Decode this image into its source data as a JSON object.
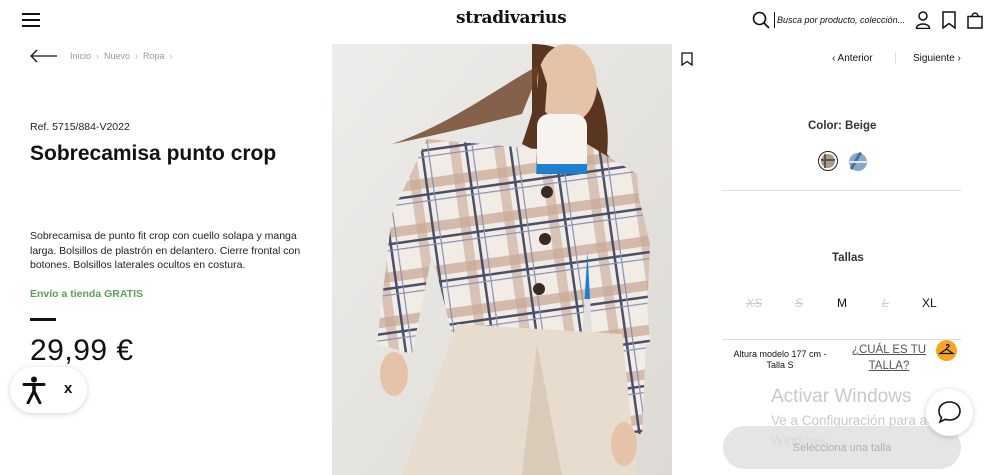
{
  "header": {
    "logo": "stradivarius",
    "search_placeholder": "Busca por producto, colección..."
  },
  "breadcrumb": {
    "items": [
      "Inicio",
      "Nuevo",
      "Ropa"
    ],
    "separator": "›"
  },
  "product": {
    "ref": "Ref. 5715/884-V2022",
    "title": "Sobrecamisa punto crop",
    "description": "Sobrecamisa de punto fit crop con cuello solapa y manga larga. Bolsillos de plastrón en delantero. Cierre frontal con botones. Bolsillos laterales ocultos en costura.",
    "shipping": "Envío a tienda GRATIS",
    "price": "29,99 €"
  },
  "accessibility_widget": {
    "close_label": "x"
  },
  "nav": {
    "prev_label": "‹ Anterior",
    "next_label": "Siguiente ›"
  },
  "color": {
    "label": "Color: Beige",
    "swatches": [
      {
        "name": "beige-plaid",
        "color": "#8a7f74",
        "selected": true
      },
      {
        "name": "blue-plaid",
        "color": "#7b96b8",
        "selected": false
      }
    ]
  },
  "sizes": {
    "label": "Tallas",
    "options": [
      {
        "label": "XS",
        "available": false
      },
      {
        "label": "S",
        "available": false
      },
      {
        "label": "M",
        "available": true
      },
      {
        "label": "L",
        "available": false
      },
      {
        "label": "XL",
        "available": true
      }
    ]
  },
  "model_info": "Altura modelo 177 cm - Talla S",
  "size_guide": "¿CUÁL ES TU TALLA?",
  "cta": {
    "select_size": "Selecciona una talla"
  },
  "windows_watermark": {
    "title": "Activar Windows",
    "subtitle": "Ve a Configuración para activar Windows."
  },
  "colors": {
    "shipping_green": "#58a25a",
    "guide_badge": "#f5a623"
  }
}
